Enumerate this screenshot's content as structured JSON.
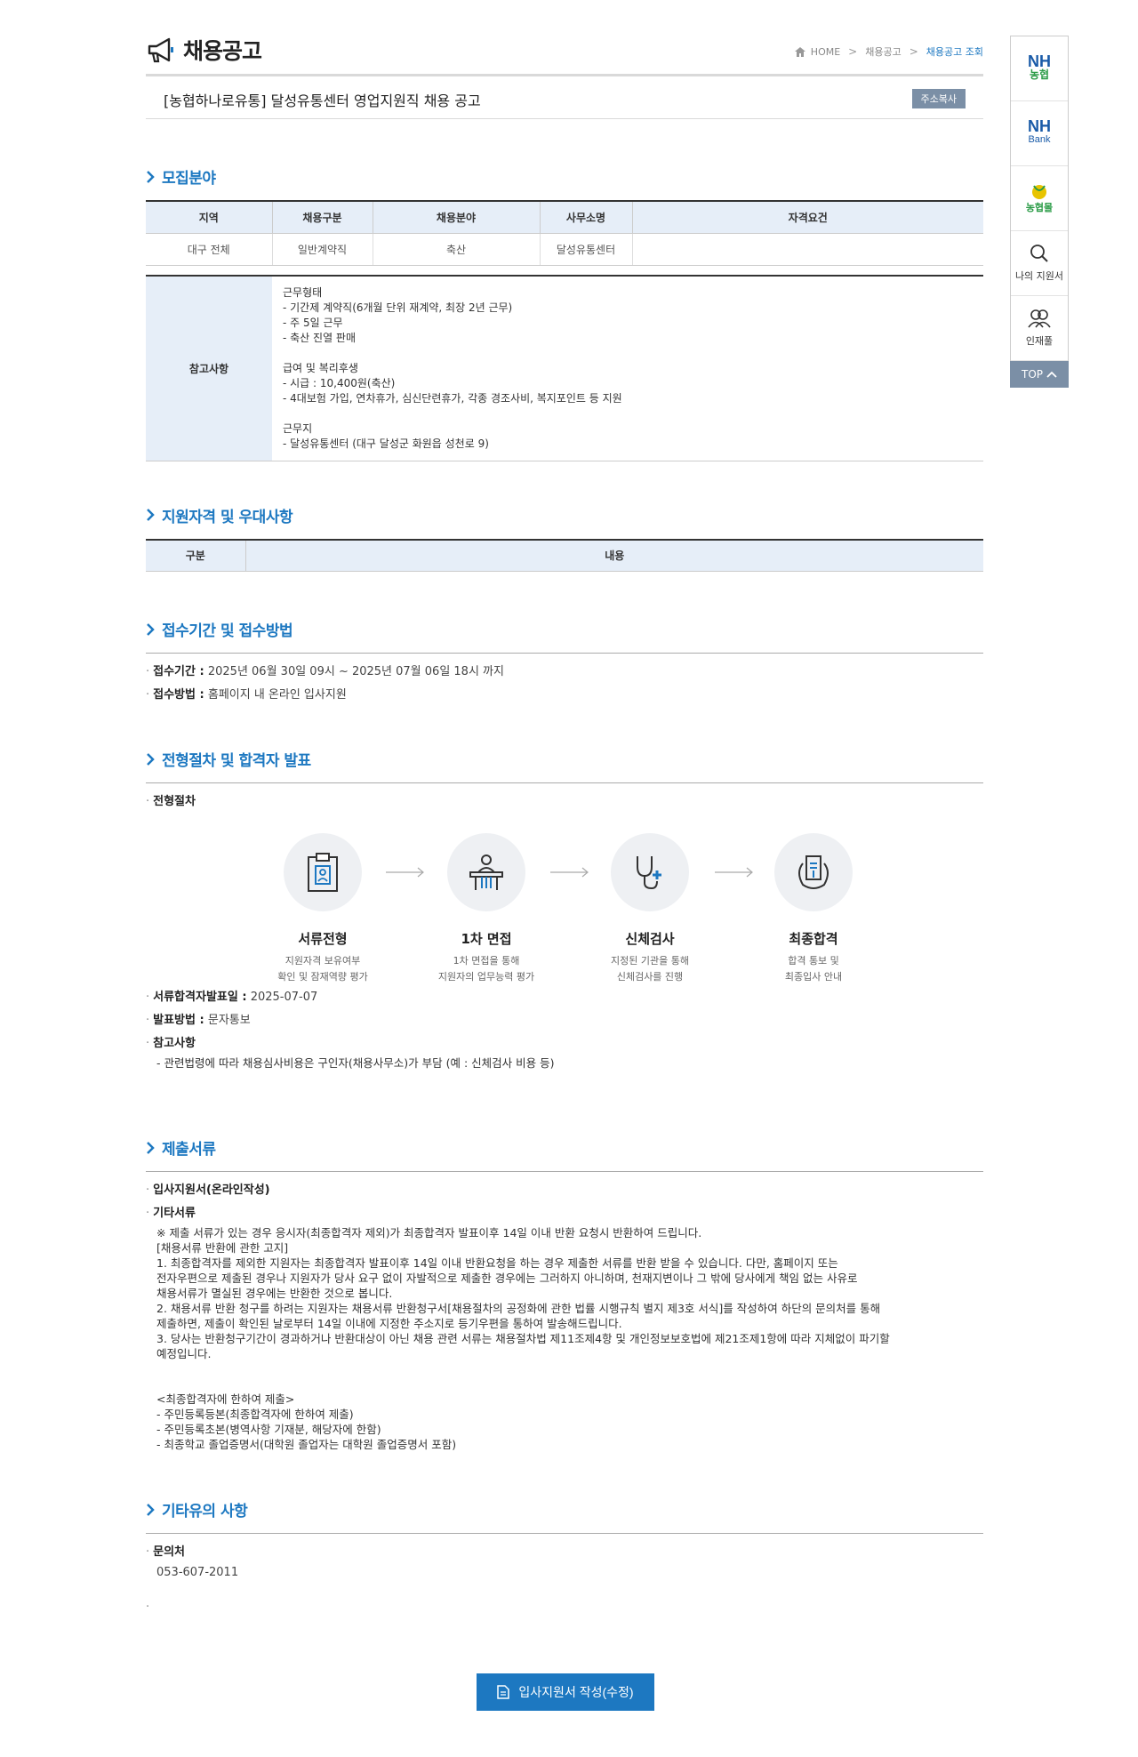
{
  "header": {
    "title": "채용공고",
    "breadcrumb": {
      "home": "HOME",
      "level1": "채용공고",
      "current": "채용공고 조회"
    }
  },
  "notice": {
    "title": "[농협하나로유통] 달성유통센터 영업지원직 채용 공고",
    "copy_label": "주소복사"
  },
  "recruit": {
    "section_title": "모집분야",
    "columns": [
      "지역",
      "채용구분",
      "채용분야",
      "사무소명",
      "자격요건"
    ],
    "row": [
      "대구 전체",
      "일반계약직",
      "축산",
      "달성유통센터",
      ""
    ],
    "ref_label": "참고사항",
    "ref_text": "근무형태\n- 기간제 계약직(6개월 단위 재계약, 최장 2년 근무)\n- 주 5일 근무\n- 축산 진열 판매\n\n급여 및 복리후생\n- 시급 : 10,400원(축산)\n- 4대보험 가입, 연차휴가, 심신단련휴가, 각종 경조사비, 복지포인트 등 지원\n\n근무지\n- 달성유통센터 (대구 달성군 화원읍 성천로 9)"
  },
  "qualification": {
    "section_title": "지원자격 및 우대사항",
    "col1": "구분",
    "col2": "내용"
  },
  "period": {
    "section_title": "접수기간 및 접수방법",
    "period_label": "접수기간 :",
    "period_value": "2025년 06월 30일 09시 ~ 2025년 07월 06일 18시 까지",
    "method_label": "접수방법 :",
    "method_value": "홈페이지 내 온라인 입사지원"
  },
  "process": {
    "section_title": "전형절차 및 합격자 발표",
    "sub_label": "전형절차",
    "steps": [
      {
        "name": "서류전형",
        "desc": "지원자격 보유여부\n확인 및 잠재역량 평가"
      },
      {
        "name": "1차 면접",
        "desc": "1차 면접을 통해\n지원자의 업무능력 평가"
      },
      {
        "name": "신체검사",
        "desc": "지정된 기관을 통해\n신체검사를 진행"
      },
      {
        "name": "최종합격",
        "desc": "합격 통보 및\n최종입사 안내"
      }
    ],
    "announce_label": "서류합격자발표일 :",
    "announce_value": "2025-07-07",
    "announce_method_label": "발표방법 :",
    "announce_method_value": "문자통보",
    "note_label": "참고사항",
    "note_value": "- 관련법령에 따라 채용심사비용은 구인자(채용사무소)가 부담 (예 : 신체검사 비용 등)"
  },
  "documents": {
    "section_title": "제출서류",
    "item1": "입사지원서(온라인작성)",
    "item2": "기타서류",
    "detail": "※ 제출 서류가 있는 경우 응시자(최종합격자 제외)가 최종합격자 발표이후 14일 이내 반환 요청시 반환하여 드립니다.\n[채용서류 반환에 관한 고지]\n 1. 최종합격자를 제외한 지원자는 최종합격자 발표이후 14일 이내 반환요청을 하는 경우 제출한 서류를 반환 받을 수 있습니다. 다만, 홈페이지 또는\n전자우편으로 제출된 경우나 지원자가 당사 요구 없이 자발적으로 제출한 경우에는 그러하지 아니하며, 천재지변이나 그 밖에 당사에게 책임 없는 사유로\n채용서류가 멸실된 경우에는 반환한 것으로 봅니다.\n 2. 채용서류 반환 청구를 하려는 지원자는 채용서류 반환청구서[채용절차의 공정화에 관한 법률 시행규칙 별지 제3호 서식]를 작성하여 하단의 문의처를 통해\n제출하면, 제출이 확인된 날로부터 14일 이내에 지정한 주소지로 등기우편을 통하여 발송해드립니다.\n 3. 당사는 반환청구기간이 경과하거나 반환대상이 아닌 채용 관련 서류는 채용절차법 제11조제4항 및 개인정보보호법에 제21조제1항에 따라 지체없이 파기할\n예정입니다.\n\n\n<최종합격자에 한하여 제출>\n- 주민등록등본(최종합격자에 한하여 제출)\n- 주민등록초본(병역사항 기재분, 해당자에 한함)\n- 최종학교 졸업증명서(대학원 졸업자는 대학원 졸업증명서 포함)"
  },
  "etc": {
    "section_title": "기타유의 사항",
    "contact_label": "문의처",
    "contact_value": "053-607-2011"
  },
  "apply_button": "입사지원서 작성(수정)",
  "quick_menu": {
    "nh_top": "NH",
    "nh_bottom": "농협",
    "bank_top": "NH",
    "bank_bottom": "Bank",
    "hanaro": "농협몰",
    "my_apply": "나의 지원서",
    "talent_pool": "인재풀",
    "top": "TOP"
  }
}
